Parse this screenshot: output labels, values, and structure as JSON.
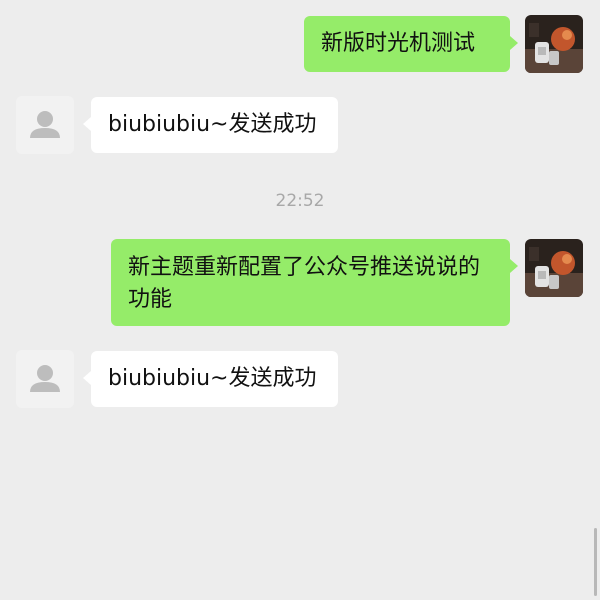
{
  "conversation": {
    "messages": [
      {
        "direction": "out",
        "text": "新版时光机测试",
        "avatar_icon": "photo-avatar-icon"
      },
      {
        "direction": "in",
        "text": "biubiubiu~发送成功",
        "avatar_icon": "default-user-avatar-icon"
      },
      {
        "type": "timestamp",
        "text": "22:52"
      },
      {
        "direction": "out",
        "text": "新主题重新配置了公众号推送说说的功能",
        "avatar_icon": "photo-avatar-icon"
      },
      {
        "direction": "in",
        "text": "biubiubiu~发送成功",
        "avatar_icon": "default-user-avatar-icon"
      }
    ]
  },
  "colors": {
    "background": "#ededed",
    "outgoing_bubble": "#95ec69",
    "incoming_bubble": "#ffffff",
    "timestamp_text": "#a8a8a8"
  }
}
